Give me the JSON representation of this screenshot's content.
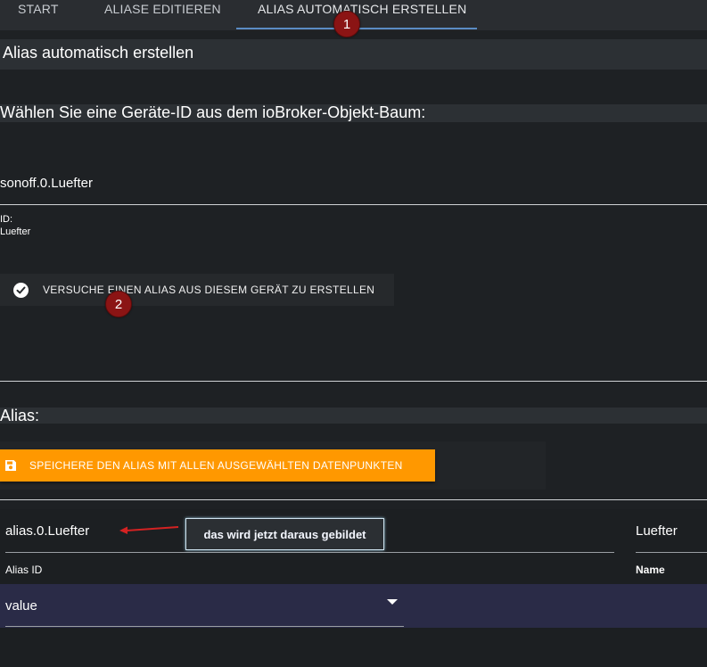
{
  "tabs": [
    {
      "label": "START"
    },
    {
      "label": "ALIASE EDITIEREN"
    },
    {
      "label": "ALIAS AUTOMATISCH ERSTELLEN"
    }
  ],
  "markers": {
    "one": "1",
    "two": "2"
  },
  "page_title": "Alias automatisch erstellen",
  "select_heading": "Wählen Sie eine Geräte-ID aus dem ioBroker-Objekt-Baum:",
  "device_value": "sonoff.0.Luefter",
  "id_info": {
    "label": "ID:",
    "value": "Luefter"
  },
  "try_button": {
    "label": "VERSUCHE EINEN ALIAS AUS DIESEM GERÄT ZU ERSTELLEN",
    "icon": "check-circle-icon"
  },
  "alias_heading": "Alias:",
  "save_button": {
    "label": "SPEICHERE DEN ALIAS MIT ALLEN AUSGEWÄHLTEN DATENPUNKTEN",
    "icon": "floppy-disk-icon",
    "color": "#ff9800"
  },
  "alias_id": {
    "value": "alias.0.Luefter",
    "label": "Alias ID"
  },
  "name": {
    "value": "Luefter",
    "label": "Name"
  },
  "callout": "das wird jetzt daraus gebildet",
  "state_select": {
    "value": "value"
  },
  "colors": {
    "accent": "#5b8cc4",
    "marker": "#8b1414",
    "annotation_arrow": "#d32222"
  }
}
